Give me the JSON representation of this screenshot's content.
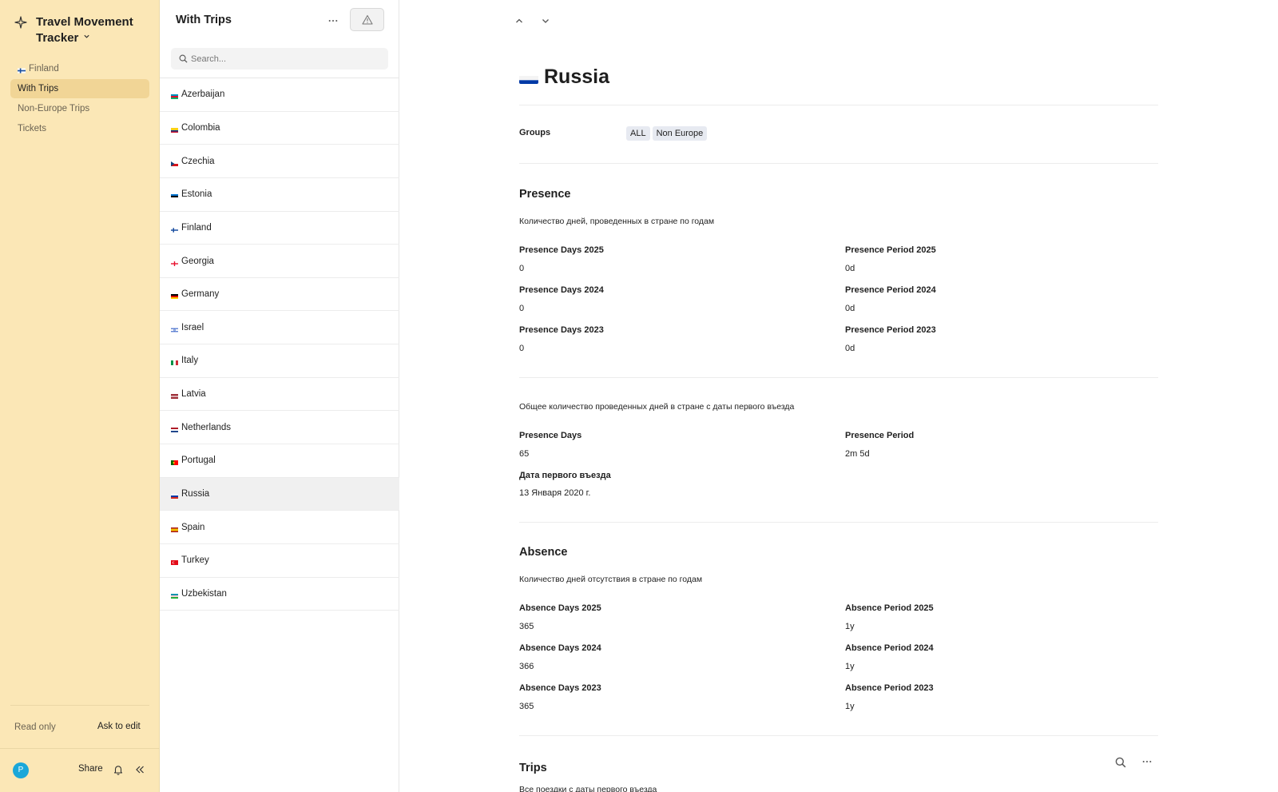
{
  "sidebar": {
    "app_title": "Travel Movement Tracker",
    "nav": [
      {
        "label": "Finland",
        "flag": "finland",
        "active": false
      },
      {
        "label": "With Trips",
        "active": true
      },
      {
        "label": "Non-Europe Trips",
        "active": false
      },
      {
        "label": "Tickets",
        "active": false
      }
    ],
    "read_only": "Read only",
    "ask_to_edit": "Ask to edit",
    "avatar_initial": "P",
    "share": "Share",
    "colors": {
      "background": "#fbe7b6",
      "active_item": "#f1d596",
      "avatar": "#1aa7d9"
    }
  },
  "list": {
    "title": "With Trips",
    "search_placeholder": "Search...",
    "countries": [
      {
        "name": "Azerbaijan",
        "flag": "azerbaijan"
      },
      {
        "name": "Colombia",
        "flag": "colombia"
      },
      {
        "name": "Czechia",
        "flag": "czechia"
      },
      {
        "name": "Estonia",
        "flag": "estonia"
      },
      {
        "name": "Finland",
        "flag": "finland"
      },
      {
        "name": "Georgia",
        "flag": "georgia"
      },
      {
        "name": "Germany",
        "flag": "germany"
      },
      {
        "name": "Israel",
        "flag": "israel"
      },
      {
        "name": "Italy",
        "flag": "italy"
      },
      {
        "name": "Latvia",
        "flag": "latvia"
      },
      {
        "name": "Netherlands",
        "flag": "netherlands"
      },
      {
        "name": "Portugal",
        "flag": "portugal"
      },
      {
        "name": "Russia",
        "flag": "russia",
        "selected": true
      },
      {
        "name": "Spain",
        "flag": "spain"
      },
      {
        "name": "Turkey",
        "flag": "turkey"
      },
      {
        "name": "Uzbekistan",
        "flag": "uzbekistan"
      }
    ]
  },
  "detail": {
    "title": "Russia",
    "title_flag": "russia",
    "groups_label": "Groups",
    "groups": [
      "ALL",
      "Non Europe"
    ],
    "presence": {
      "title": "Presence",
      "yearly_desc": "Количество дней, проведенных в стране по годам",
      "yearly": [
        {
          "days_label": "Presence Days 2025",
          "days": "0",
          "period_label": "Presence Period 2025",
          "period": "0d"
        },
        {
          "days_label": "Presence Days 2024",
          "days": "0",
          "period_label": "Presence Period 2024",
          "period": "0d"
        },
        {
          "days_label": "Presence Days 2023",
          "days": "0",
          "period_label": "Presence Period 2023",
          "period": "0d"
        }
      ],
      "total_desc": "Общее количество проведенных дней в стране с даты первого въезда",
      "total_days_label": "Presence Days",
      "total_days": "65",
      "total_period_label": "Presence Period",
      "total_period": "2m 5d",
      "first_entry_label": "Дата первого въезда",
      "first_entry": "13 Января 2020 г."
    },
    "absence": {
      "title": "Absence",
      "yearly_desc": "Количество дней отсутствия в стране по годам",
      "yearly": [
        {
          "days_label": "Absence Days 2025",
          "days": "365",
          "period_label": "Absence Period 2025",
          "period": "1y"
        },
        {
          "days_label": "Absence Days 2024",
          "days": "366",
          "period_label": "Absence Period 2024",
          "period": "1y"
        },
        {
          "days_label": "Absence Days 2023",
          "days": "365",
          "period_label": "Absence Period 2023",
          "period": "1y"
        }
      ]
    },
    "trips": {
      "title": "Trips",
      "desc": "Все поездки с даты первого въезда"
    }
  },
  "icons": {
    "app": "app-logo-icon",
    "chevron_down": "chevron-down-icon",
    "more": "more-horizontal-icon",
    "warning": "warning-icon",
    "search": "search-icon",
    "bell": "bell-icon",
    "collapse": "collapse-sidebar-icon",
    "up": "chevron-up-icon",
    "down": "chevron-down-icon"
  }
}
